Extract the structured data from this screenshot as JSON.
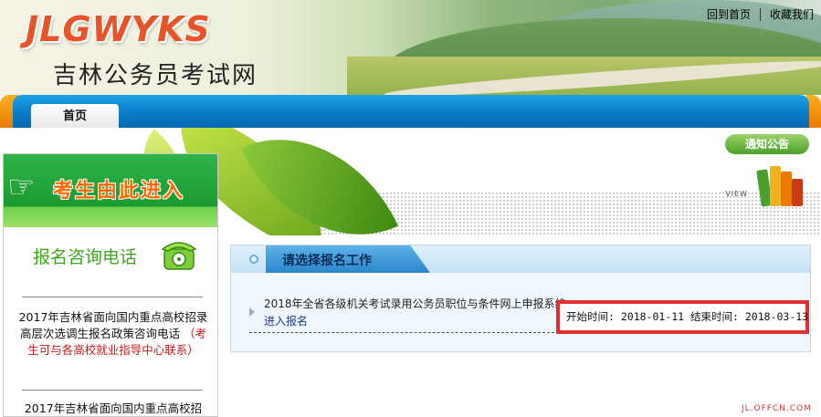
{
  "header": {
    "logo": "JLGWYKS",
    "site_name": "吉林公务员考试网",
    "links": {
      "home": "回到首页",
      "favorite": "收藏我们"
    }
  },
  "nav": {
    "tabs": [
      {
        "label": "首页"
      }
    ]
  },
  "banner": {
    "notice_label": "通知公告",
    "view_label": "VIEW"
  },
  "sidebar": {
    "entry_label": "考生由此进入",
    "phone_title": "报名咨询电话",
    "news": [
      {
        "text": "2017年吉林省面向国内重点高校招录高层次选调生报名政策咨询电话",
        "note": "（考生可与各高校就业指导中心联系）"
      },
      {
        "text": "2017年吉林省面向国内重点高校招"
      }
    ]
  },
  "panel": {
    "title": "请选择报名工作",
    "item": {
      "title": "2018年全省各级机关考试录用公务员职位与条件网上申报系统",
      "link": "进入报名",
      "time": "开始时间: 2018-01-11  结束时间: 2018-03-13"
    }
  },
  "watermark": "JL.OFFCN.COM",
  "colors": {
    "nav_blue": "#0a7cc8",
    "accent_green": "#3aa81a",
    "highlight_red": "#e03030",
    "orange": "#ff6a00"
  }
}
